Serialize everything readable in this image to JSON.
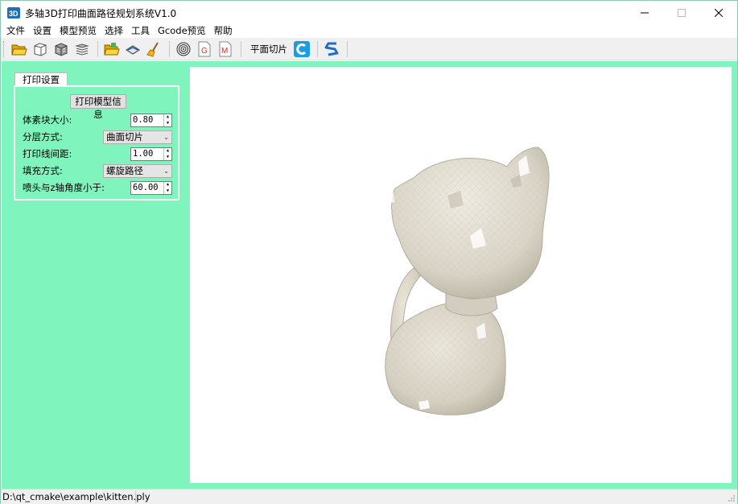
{
  "window": {
    "title": "多轴3D打印曲面路径规划系统V1.0",
    "controls": [
      "minimize-icon",
      "maximize-icon",
      "close-icon"
    ]
  },
  "menu": [
    "文件",
    "设置",
    "模型预览",
    "选择",
    "工具",
    "Gcode预览",
    "帮助"
  ],
  "toolbar": {
    "icons": [
      "open-folder-icon",
      "cube-wireframe-icon",
      "voxel-cube-icon",
      "layers-icon",
      "open-folder-2-icon",
      "slice-icon",
      "broom-icon",
      "spiral-icon",
      "gcode-file-icon",
      "m-file-icon"
    ],
    "plane_slice_label": "平面切片",
    "end_icons": [
      "cura-icon",
      "simplify-icon"
    ]
  },
  "panel": {
    "tab_label": "打印设置",
    "info_button": "打印模型信息",
    "voxel_size_label": "体素块大小:",
    "voxel_size_value": "0.80",
    "layering_label": "分层方式:",
    "layering_value": "曲面切片",
    "line_spacing_label": "打印线间距:",
    "line_spacing_value": "1.00",
    "fill_label": "填充方式:",
    "fill_value": "螺旋路径",
    "angle_label": "喷头与z轴角度小于:",
    "angle_value": "60.00"
  },
  "viewport": {
    "model": "kitten-3d-model"
  },
  "status": {
    "path": "D:\\qt_cmake\\example\\kitten.ply"
  },
  "colors": {
    "panel_bg": "#7ff5bd",
    "model_fill": "#ddd8cb",
    "viewport_bg": "#ffffff"
  }
}
